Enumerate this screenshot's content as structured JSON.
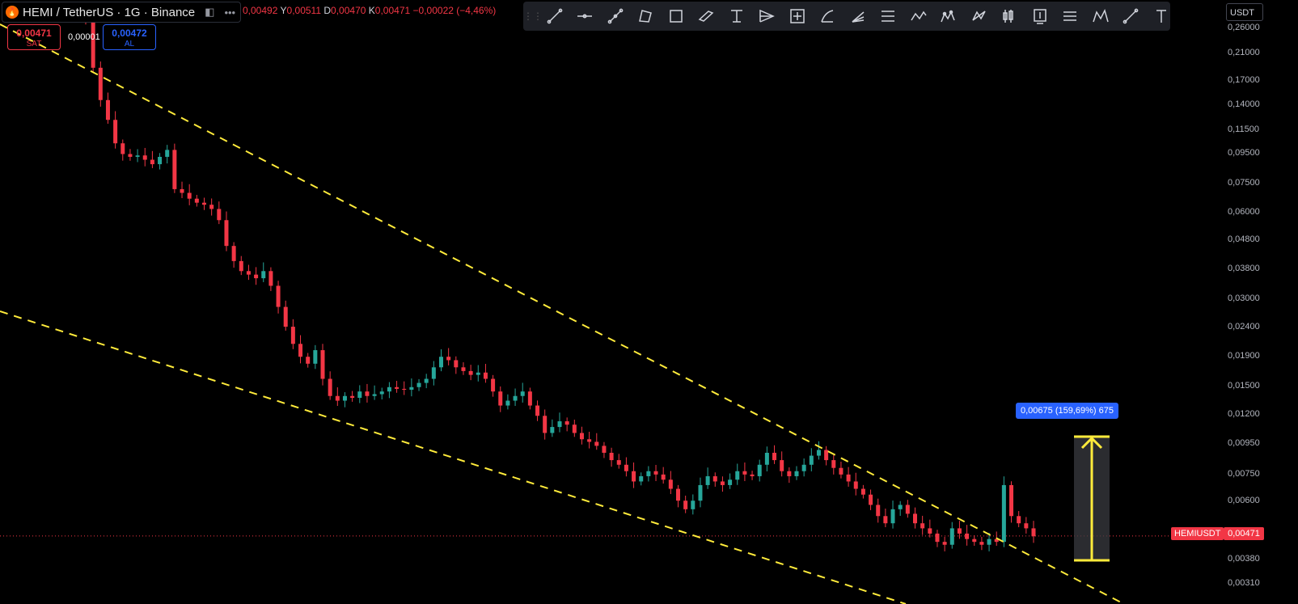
{
  "header": {
    "title": "HEMI / TetherUS · 1G · Binance",
    "logo_icon": "flame-icon",
    "eye_icon": "hide-icon",
    "more_icon": "more-dots-icon"
  },
  "ohlc": {
    "open_value": "0,00492",
    "high_label": "Y",
    "high_value": "0,00511",
    "low_label": "D",
    "low_value": "0,00470",
    "close_label": "K",
    "close_value": "0,00471",
    "change": "−0,00022 (−4,46%)"
  },
  "trade": {
    "sell_price": "0,00471",
    "sell_label": "SAT",
    "spread": "0,00001",
    "buy_price": "0,00472",
    "buy_label": "AL"
  },
  "toolbar": {
    "icons": [
      "trend-line-icon",
      "horizontal-ray-icon",
      "info-line-icon",
      "polyline-icon",
      "rectangle-icon",
      "parallel-channel-icon",
      "anchored-text-icon",
      "pitchfork-icon",
      "crosshair-box-icon",
      "arc-icon",
      "fib-fan-icon",
      "fib-retracement-icon",
      "zigzag-icon",
      "pattern-icon",
      "xabcd-icon",
      "candles-icon",
      "price-note-icon",
      "long-position-icon",
      "head-shoulders-icon",
      "ruler-icon",
      "text-icon"
    ]
  },
  "currency": "USDT",
  "y_axis": [
    "0,26000",
    "0,21000",
    "0,17000",
    "0,14000",
    "0,11500",
    "0,09500",
    "0,07500",
    "0,06000",
    "0,04800",
    "0,03800",
    "0,03000",
    "0,02400",
    "0,01900",
    "0,01500",
    "0,01200",
    "0,00950",
    "0,00750",
    "0,00600",
    "0,00471",
    "0,00380",
    "0,00310"
  ],
  "symbol_label": "HEMIUSDT",
  "last_price": "0,00471",
  "measure_label": "0,00675 (159,69%) 675",
  "colors": {
    "up": "#26a69a",
    "down": "#f23645",
    "trendline": "#ffeb3b",
    "background": "#000000"
  },
  "chart_data": {
    "type": "candlestick",
    "scale": "log",
    "ylim": [
      0.0029,
      0.29
    ],
    "last_value": 0.00471,
    "series_close": [
      0.26,
      0.18,
      0.14,
      0.12,
      0.1,
      0.092,
      0.09,
      0.091,
      0.088,
      0.085,
      0.09,
      0.095,
      0.07,
      0.068,
      0.065,
      0.063,
      0.062,
      0.06,
      0.055,
      0.045,
      0.04,
      0.037,
      0.036,
      0.035,
      0.037,
      0.033,
      0.028,
      0.024,
      0.021,
      0.019,
      0.018,
      0.02,
      0.016,
      0.014,
      0.0135,
      0.014,
      0.0138,
      0.0145,
      0.014,
      0.0142,
      0.0145,
      0.015,
      0.0148,
      0.0147,
      0.015,
      0.0155,
      0.016,
      0.0175,
      0.019,
      0.0185,
      0.0175,
      0.017,
      0.0165,
      0.0168,
      0.016,
      0.0145,
      0.013,
      0.0135,
      0.014,
      0.0145,
      0.013,
      0.012,
      0.0105,
      0.011,
      0.0115,
      0.0112,
      0.0105,
      0.01,
      0.0098,
      0.0095,
      0.009,
      0.0085,
      0.0082,
      0.0078,
      0.0072,
      0.0075,
      0.0078,
      0.0076,
      0.0073,
      0.0068,
      0.0062,
      0.0058,
      0.0062,
      0.007,
      0.0075,
      0.0072,
      0.007,
      0.0073,
      0.0078,
      0.0076,
      0.0075,
      0.0082,
      0.009,
      0.0085,
      0.0078,
      0.0075,
      0.0078,
      0.0082,
      0.0088,
      0.0092,
      0.0085,
      0.008,
      0.0076,
      0.0072,
      0.0068,
      0.0065,
      0.006,
      0.0055,
      0.0052,
      0.0058,
      0.006,
      0.0056,
      0.0052,
      0.005,
      0.0048,
      0.0045,
      0.0044,
      0.005,
      0.0048,
      0.0046,
      0.0045,
      0.0044,
      0.0046,
      0.0045,
      0.007,
      0.0055,
      0.0052,
      0.005,
      0.0047
    ],
    "annotations": [
      "upper descending trendline",
      "lower descending trendline",
      "measure 0,00675 (159,69%)"
    ]
  }
}
